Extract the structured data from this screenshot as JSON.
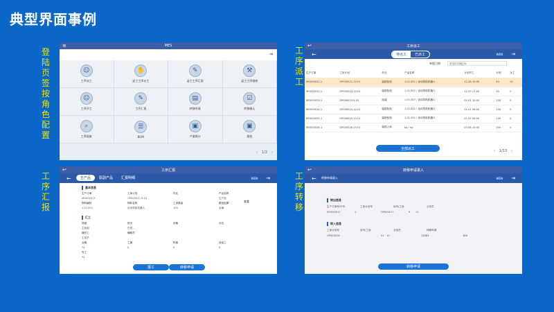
{
  "slide_title": "典型界面事例",
  "side_labels": {
    "login": "登陆页签按角色配置",
    "dispatch": "工序派工",
    "report": "工序汇报",
    "transfer": "工序转移"
  },
  "panel_login": {
    "title": "MES",
    "tiles": [
      {
        "label": "工序派工",
        "icon": "person-icon"
      },
      {
        "label": "返工工序派工",
        "icon": "hand-icon"
      },
      {
        "label": "返工工序汇报",
        "icon": "document-edit-icon"
      },
      {
        "label": "返工工序维修",
        "icon": "wrench-icon"
      },
      {
        "label": "工序开工",
        "icon": "person-icon"
      },
      {
        "label": "工序汇报",
        "icon": "document-edit-icon"
      },
      {
        "label": "转移申请",
        "icon": "document-icon"
      },
      {
        "label": "转移确认",
        "icon": "document-check-icon"
      },
      {
        "label": "工序报废",
        "icon": "magnifier-icon"
      },
      {
        "label": "BOM",
        "icon": "list-icon"
      },
      {
        "label": "产量统计",
        "icon": "box-icon"
      },
      {
        "label": "报检",
        "icon": "box-icon"
      }
    ],
    "pager": "1/2",
    "prev": "‹",
    "next": "›"
  },
  "panel_dispatch": {
    "title": "工序派工",
    "tabs": [
      "待派工",
      "已派工"
    ],
    "user": "WEN",
    "filter_label": "单据日期",
    "filter_placeholder": "请选择日期区间",
    "columns": [
      "生产订单",
      "工序计划",
      "作业",
      "产品名称",
      "计划开工",
      "计划",
      "派工"
    ],
    "rows": [
      [
        "MO000021-1",
        "OP000021-10-01",
        "装配检验",
        "1.01.001 / 自动导航机器人",
        "12-28 10:00",
        "40",
        "10"
      ],
      [
        "MO000022-1",
        "OP000022-10-01",
        "装配检验",
        "1.01.001 / 自动导航机器人",
        "12-29 17:00",
        "30",
        "0"
      ],
      [
        "MO000023-1",
        "OP000023-9-05",
        "组装",
        "1.01.007 / 自动导航机器人",
        "01-01 10:00",
        "100",
        "0"
      ],
      [
        "MO000024-1",
        "OP000024-10-01",
        "装配检验",
        "1.01.001 / 自动导航机器人",
        "01-01 08:00",
        "100",
        "0"
      ],
      [
        "MO000025-1",
        "OP000025-10-01",
        "装配检验",
        "1.01.001 / 自动导航机器人",
        "01-02 09:00",
        "100",
        "0"
      ],
      [
        "MO000026-1",
        "OP000026-10-01",
        "装配入库",
        "kg / kg",
        "03-08 10:00",
        "100",
        "0"
      ]
    ],
    "action": "全部派工",
    "pager": "1/13"
  },
  "panel_report": {
    "title": "工序汇报",
    "tabs": [
      "生产品",
      "联副产品",
      "汇报明细"
    ],
    "user": "WEN",
    "section1": "基本信息",
    "fields_row1": [
      {
        "label": "生产订单",
        "value": "MO000017"
      },
      {
        "label": "工序计划",
        "value": "OP000017-9-10"
      },
      {
        "label": "作业",
        "value": ""
      },
      {
        "label": "产品名称",
        "value": "生产品"
      }
    ],
    "fields_row2": [
      {
        "label": "物料编码",
        "value": "1.01.001"
      },
      {
        "label": "物料名称",
        "value": "自动导航机器人"
      },
      {
        "label": "工序数量",
        "value": "100"
      },
      {
        "label": "数检结果",
        "value": "合格"
      }
    ],
    "section2": "汇工",
    "fields_row3": [
      {
        "label": "班组",
        "value": "主检组"
      },
      {
        "label": "班次",
        "value": "白班"
      },
      {
        "label": "设备",
        "value": ""
      },
      {
        "label": "仓位",
        "value": ""
      }
    ],
    "fields_row4": [
      {
        "label": "操作工",
        "value": "主检员"
      },
      {
        "label": "辅助员",
        "value": ""
      }
    ],
    "fields_row5": [
      {
        "label": "合格",
        "value": "74"
      },
      {
        "label": "工废",
        "value": "0"
      },
      {
        "label": "料废",
        "value": "0"
      },
      {
        "label": "待返工",
        "value": "0"
      }
    ],
    "fields_row6": [
      {
        "label": "完工",
        "value": "74"
      }
    ],
    "btn_report": "报工",
    "btn_transfer": "转移申请"
  },
  "panel_transfer": {
    "title": "转移申请录入",
    "subtitle": "转移申请录入",
    "user": "WEN",
    "section1": "转出信息",
    "out_labels": [
      "生产订单号/行号",
      "工序计划号",
      "序列/工序",
      "业务员"
    ],
    "out_values": [
      "MO000017",
      "1",
      "OP000017",
      "9",
      "10"
    ],
    "section2": "转入信息",
    "in_labels": [
      "工序计划号",
      "序列/工序",
      "业务员",
      "转移申请"
    ],
    "in_values": [
      "OP000018",
      "01",
      "10",
      "11001",
      "100"
    ],
    "action": "转移申请"
  }
}
